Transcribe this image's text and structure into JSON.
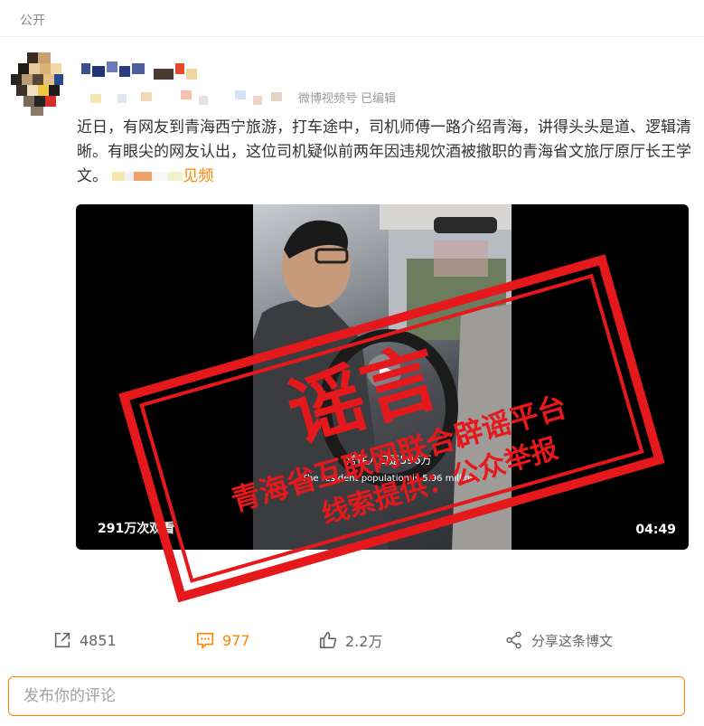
{
  "post": {
    "visibility": "公开",
    "source_text": "微博视频号 已编辑",
    "content": "近日，有网友到青海西宁旅游，打车途中，司机师傅一路介绍青海，讲得头头是道、逻辑清晰。有眼尖的网友认出，这位司机疑似前两年因违规饮酒被撤职的青海省文旅厅原厅长王学文。",
    "more_suffix": "见频"
  },
  "video": {
    "views": "291万次观看",
    "duration": "04:49",
    "subtitle_cn": "常住人口是596万",
    "subtitle_en": "The resident population is 5.96 million"
  },
  "stamp": {
    "main": "谣言",
    "line1": "青海省互联网联合辟谣平台",
    "line2": "线索提供：公众举报",
    "color": "#e5191c"
  },
  "actions": {
    "repost": "4851",
    "comment": "977",
    "like": "2.2万",
    "share": "分享这条博文"
  },
  "comment_box": {
    "placeholder": "发布你的评论"
  },
  "colors": {
    "accent": "#ff8200",
    "stamp_red": "#e5191c"
  }
}
